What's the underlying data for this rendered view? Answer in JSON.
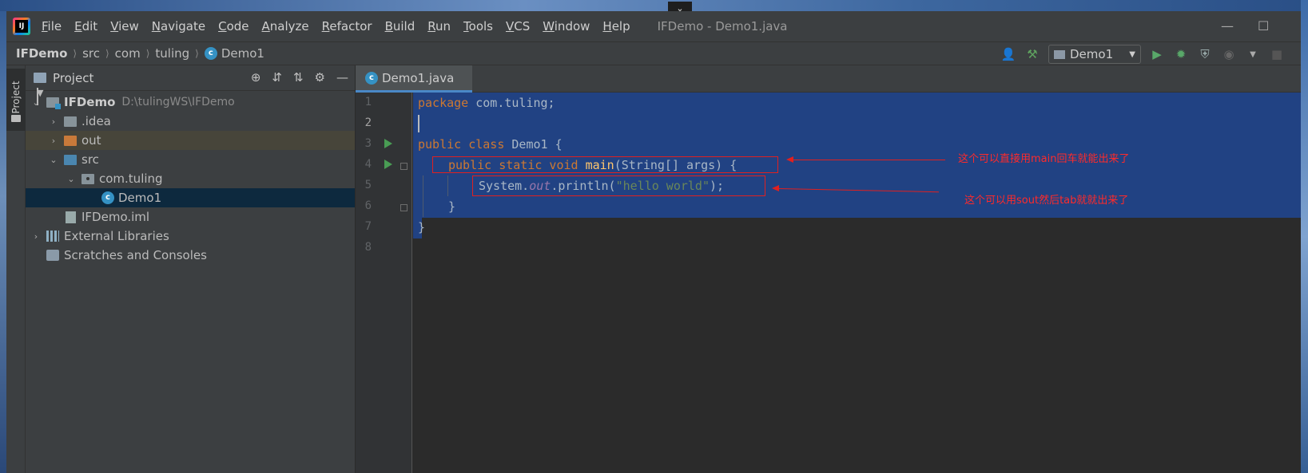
{
  "menu": [
    "File",
    "Edit",
    "View",
    "Navigate",
    "Code",
    "Analyze",
    "Refactor",
    "Build",
    "Run",
    "Tools",
    "VCS",
    "Window",
    "Help"
  ],
  "window_title": "IFDemo - Demo1.java",
  "breadcrumb": {
    "project": "IFDemo",
    "items": [
      "src",
      "com",
      "tuling"
    ],
    "file": "Demo1"
  },
  "run_config": "Demo1",
  "stripe_label": "Project",
  "project_panel": {
    "title": "Project",
    "tree": {
      "root": {
        "name": "IFDemo",
        "path": "D:\\tulingWS\\IFDemo"
      },
      "idea": ".idea",
      "out": "out",
      "src": "src",
      "pkg": "com.tuling",
      "cls": "Demo1",
      "iml": "IFDemo.iml",
      "libs": "External Libraries",
      "scratches": "Scratches and Consoles"
    }
  },
  "editor": {
    "tab": "Demo1.java",
    "line_numbers": [
      "1",
      "2",
      "3",
      "4",
      "5",
      "6",
      "7",
      "8"
    ],
    "code": {
      "l1_kw": "package",
      "l1_rest": " com.tuling;",
      "l3_kw": "public class",
      "l3_rest": " Demo1 {",
      "l4_kw": "public static void",
      "l4_fn": "main",
      "l4_rest": "(String[] args) {",
      "l5_a": "System.",
      "l5_out": "out",
      "l5_b": ".println(",
      "l5_str": "\"hello world\"",
      "l5_c": ");",
      "l6": "}",
      "l7": "}"
    }
  },
  "annotations": {
    "main_tip": "这个可以直接用main回车就能出来了",
    "sout_tip": "这个可以用sout然后tab就就出来了"
  },
  "colors": {
    "keyword": "#cc7832",
    "string": "#6a8759",
    "selection": "#214283",
    "annotation": "#e02020"
  }
}
